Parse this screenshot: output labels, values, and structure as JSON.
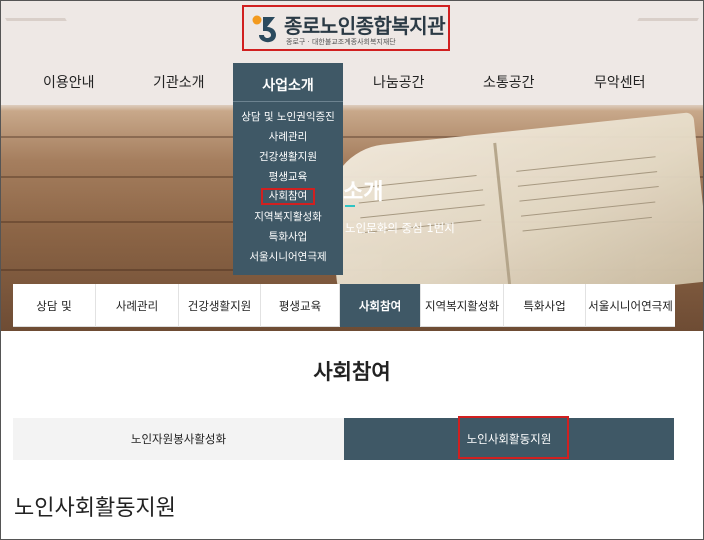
{
  "header": {
    "logo_title": "종로노인종합복지관",
    "logo_subtitle": "종로구 · 대한불교조계종사회복지재단"
  },
  "nav": {
    "items": [
      "이용안내",
      "기관소개",
      "사업소개",
      "나눔공간",
      "소통공간",
      "무악센터"
    ]
  },
  "dropdown": {
    "title": "사업소개",
    "items": [
      "상담 및 노인권익증진",
      "사례관리",
      "건강생활지원",
      "평생교육",
      "사회참여",
      "지역복지활성화",
      "특화사업",
      "서울시니어연극제"
    ],
    "highlighted": "사회참여"
  },
  "hero": {
    "title": "소개",
    "subtitle": "노인문화의 중심 1번지"
  },
  "subtabs": {
    "items": [
      "상담 및",
      "사례관리",
      "건강생활지원",
      "평생교육",
      "사회참여",
      "지역복지활성화",
      "특화사업",
      "서울시니어연극제"
    ],
    "active": "사회참여"
  },
  "page_title": "사회참여",
  "content_tabs": {
    "items": [
      "노인자원봉사활성화",
      "노인사회활동지원"
    ],
    "active": "노인사회활동지원"
  },
  "section_title": "노인사회활동지원",
  "colors": {
    "accent_dark": "#3f5866",
    "highlight_red": "#d12020",
    "hero_accent": "#2ec4c4"
  }
}
